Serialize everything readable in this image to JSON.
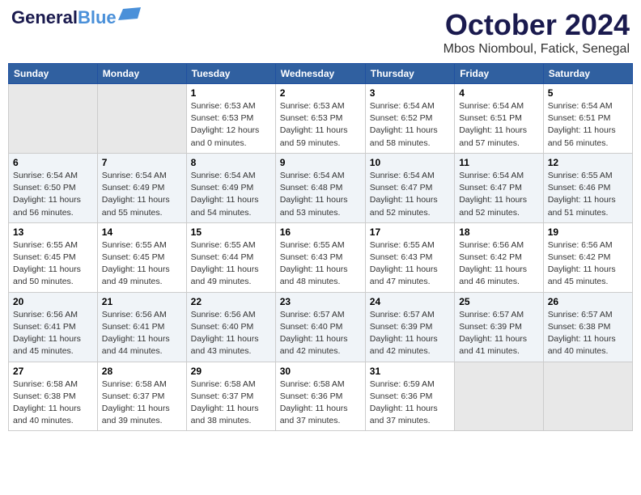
{
  "header": {
    "logo_line1": "General",
    "logo_line2": "Blue",
    "month": "October 2024",
    "location": "Mbos Niomboul, Fatick, Senegal"
  },
  "days_of_week": [
    "Sunday",
    "Monday",
    "Tuesday",
    "Wednesday",
    "Thursday",
    "Friday",
    "Saturday"
  ],
  "weeks": [
    [
      {
        "day": "",
        "info": ""
      },
      {
        "day": "",
        "info": ""
      },
      {
        "day": "1",
        "info": "Sunrise: 6:53 AM\nSunset: 6:53 PM\nDaylight: 12 hours\nand 0 minutes."
      },
      {
        "day": "2",
        "info": "Sunrise: 6:53 AM\nSunset: 6:53 PM\nDaylight: 11 hours\nand 59 minutes."
      },
      {
        "day": "3",
        "info": "Sunrise: 6:54 AM\nSunset: 6:52 PM\nDaylight: 11 hours\nand 58 minutes."
      },
      {
        "day": "4",
        "info": "Sunrise: 6:54 AM\nSunset: 6:51 PM\nDaylight: 11 hours\nand 57 minutes."
      },
      {
        "day": "5",
        "info": "Sunrise: 6:54 AM\nSunset: 6:51 PM\nDaylight: 11 hours\nand 56 minutes."
      }
    ],
    [
      {
        "day": "6",
        "info": "Sunrise: 6:54 AM\nSunset: 6:50 PM\nDaylight: 11 hours\nand 56 minutes."
      },
      {
        "day": "7",
        "info": "Sunrise: 6:54 AM\nSunset: 6:49 PM\nDaylight: 11 hours\nand 55 minutes."
      },
      {
        "day": "8",
        "info": "Sunrise: 6:54 AM\nSunset: 6:49 PM\nDaylight: 11 hours\nand 54 minutes."
      },
      {
        "day": "9",
        "info": "Sunrise: 6:54 AM\nSunset: 6:48 PM\nDaylight: 11 hours\nand 53 minutes."
      },
      {
        "day": "10",
        "info": "Sunrise: 6:54 AM\nSunset: 6:47 PM\nDaylight: 11 hours\nand 52 minutes."
      },
      {
        "day": "11",
        "info": "Sunrise: 6:54 AM\nSunset: 6:47 PM\nDaylight: 11 hours\nand 52 minutes."
      },
      {
        "day": "12",
        "info": "Sunrise: 6:55 AM\nSunset: 6:46 PM\nDaylight: 11 hours\nand 51 minutes."
      }
    ],
    [
      {
        "day": "13",
        "info": "Sunrise: 6:55 AM\nSunset: 6:45 PM\nDaylight: 11 hours\nand 50 minutes."
      },
      {
        "day": "14",
        "info": "Sunrise: 6:55 AM\nSunset: 6:45 PM\nDaylight: 11 hours\nand 49 minutes."
      },
      {
        "day": "15",
        "info": "Sunrise: 6:55 AM\nSunset: 6:44 PM\nDaylight: 11 hours\nand 49 minutes."
      },
      {
        "day": "16",
        "info": "Sunrise: 6:55 AM\nSunset: 6:43 PM\nDaylight: 11 hours\nand 48 minutes."
      },
      {
        "day": "17",
        "info": "Sunrise: 6:55 AM\nSunset: 6:43 PM\nDaylight: 11 hours\nand 47 minutes."
      },
      {
        "day": "18",
        "info": "Sunrise: 6:56 AM\nSunset: 6:42 PM\nDaylight: 11 hours\nand 46 minutes."
      },
      {
        "day": "19",
        "info": "Sunrise: 6:56 AM\nSunset: 6:42 PM\nDaylight: 11 hours\nand 45 minutes."
      }
    ],
    [
      {
        "day": "20",
        "info": "Sunrise: 6:56 AM\nSunset: 6:41 PM\nDaylight: 11 hours\nand 45 minutes."
      },
      {
        "day": "21",
        "info": "Sunrise: 6:56 AM\nSunset: 6:41 PM\nDaylight: 11 hours\nand 44 minutes."
      },
      {
        "day": "22",
        "info": "Sunrise: 6:56 AM\nSunset: 6:40 PM\nDaylight: 11 hours\nand 43 minutes."
      },
      {
        "day": "23",
        "info": "Sunrise: 6:57 AM\nSunset: 6:40 PM\nDaylight: 11 hours\nand 42 minutes."
      },
      {
        "day": "24",
        "info": "Sunrise: 6:57 AM\nSunset: 6:39 PM\nDaylight: 11 hours\nand 42 minutes."
      },
      {
        "day": "25",
        "info": "Sunrise: 6:57 AM\nSunset: 6:39 PM\nDaylight: 11 hours\nand 41 minutes."
      },
      {
        "day": "26",
        "info": "Sunrise: 6:57 AM\nSunset: 6:38 PM\nDaylight: 11 hours\nand 40 minutes."
      }
    ],
    [
      {
        "day": "27",
        "info": "Sunrise: 6:58 AM\nSunset: 6:38 PM\nDaylight: 11 hours\nand 40 minutes."
      },
      {
        "day": "28",
        "info": "Sunrise: 6:58 AM\nSunset: 6:37 PM\nDaylight: 11 hours\nand 39 minutes."
      },
      {
        "day": "29",
        "info": "Sunrise: 6:58 AM\nSunset: 6:37 PM\nDaylight: 11 hours\nand 38 minutes."
      },
      {
        "day": "30",
        "info": "Sunrise: 6:58 AM\nSunset: 6:36 PM\nDaylight: 11 hours\nand 37 minutes."
      },
      {
        "day": "31",
        "info": "Sunrise: 6:59 AM\nSunset: 6:36 PM\nDaylight: 11 hours\nand 37 minutes."
      },
      {
        "day": "",
        "info": ""
      },
      {
        "day": "",
        "info": ""
      }
    ]
  ]
}
